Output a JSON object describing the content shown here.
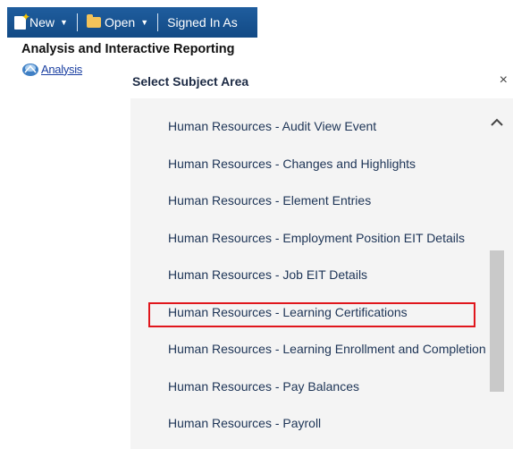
{
  "toolbar": {
    "new_label": "New",
    "open_label": "Open",
    "signed_in_label": "Signed In As"
  },
  "heading": "Analysis and Interactive Reporting",
  "analysis_link": "Analysis",
  "dialog": {
    "title": "Select Subject Area",
    "close": "×",
    "items": [
      "Human Resources - Audit View Event",
      "Human Resources - Changes and Highlights",
      "Human Resources - Element Entries",
      "Human Resources - Employment Position EIT Details",
      "Human Resources - Job EIT Details",
      "Human Resources - Learning Certifications",
      "Human Resources - Learning Enrollment and Completion",
      "Human Resources - Pay Balances",
      "Human Resources - Payroll"
    ],
    "highlighted_item": "Human Resources - Learning Certifications"
  },
  "colors": {
    "toolbar": "#1a5494",
    "highlight": "#e0161c",
    "link": "#1a3fa1",
    "list_background": "#f4f4f4"
  }
}
